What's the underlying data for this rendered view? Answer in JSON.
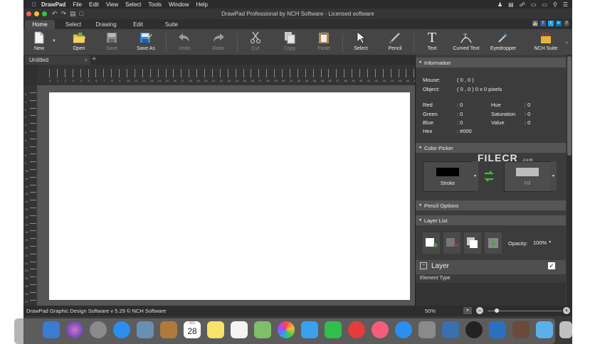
{
  "menubar": {
    "apple_icon": "apple-icon",
    "app_name": "DrawPad",
    "items": [
      "File",
      "Edit",
      "View",
      "Select",
      "Tools",
      "Window",
      "Help"
    ]
  },
  "window": {
    "title": "DrawPad Professional by NCH Software - Licensed software"
  },
  "ribbon": {
    "tabs": [
      "Home",
      "Select",
      "Drawing",
      "Edit",
      "Suite"
    ],
    "active_tab": "Home"
  },
  "toolbar": {
    "new": "New",
    "open": "Open",
    "save": "Save",
    "save_as": "Save As",
    "undo": "Undo",
    "redo": "Redo",
    "cut": "Cut",
    "copy": "Copy",
    "paste": "Paste",
    "select": "Select",
    "pencil": "Pencil",
    "text": "Text",
    "curved_text": "Curved Text",
    "eyedropper": "Eyedropper",
    "nch_suite": "NCH Suite"
  },
  "document": {
    "tab_label": "Untitled",
    "close_glyph": "×",
    "add_glyph": "+"
  },
  "ruler": {
    "h_labels": [
      "0",
      "1",
      "2",
      "3",
      "4",
      "5",
      "6",
      "7",
      "8",
      "9",
      "10",
      "11",
      "12",
      "13",
      "14",
      "15",
      "16",
      "17",
      "18",
      "19",
      "20",
      "21",
      "22",
      "23",
      "24",
      "25",
      "26",
      "27",
      "28",
      "29",
      "30",
      "31",
      "32",
      "33",
      "34",
      "35",
      "36",
      "37",
      "38",
      "39",
      "40",
      "41",
      "42",
      "43",
      "44",
      "45",
      "46",
      "47"
    ],
    "v_labels": [
      "0",
      "1",
      "2",
      "3",
      "4",
      "5",
      "6",
      "7",
      "8",
      "9",
      "10",
      "11",
      "12",
      "13",
      "14",
      "15",
      "16",
      "17",
      "18",
      "19",
      "20",
      "21",
      "22",
      "23",
      "24",
      "25",
      "26",
      "27"
    ]
  },
  "information": {
    "header": "Information",
    "mouse_label": "Mouse:",
    "mouse_value": "( 0 , 0 )",
    "object_label": "Object:",
    "object_value": "( 0 , 0 ) 0 x 0 pixels",
    "red_label": "Red",
    "red_value": ": 0",
    "green_label": "Green",
    "green_value": ": 0",
    "blue_label": "Blue",
    "blue_value": ": 0",
    "hex_label": "Hex",
    "hex_value": ": #000",
    "hue_label": "Hue",
    "hue_value": ": 0",
    "saturation_label": "Saturation",
    "saturation_value": ": 0",
    "value_label": "Value",
    "value_value": ": 0"
  },
  "color_picker": {
    "header": "Color Picker",
    "stroke_label": "Stroke",
    "fill_label": "Fill",
    "stroke_color": "#000000",
    "fill_color": "#bdbdbd"
  },
  "pencil_options": {
    "header": "Pencil Options"
  },
  "layer_list": {
    "header": "Layer List",
    "opacity_label": "Opacity:",
    "opacity_value": "100%",
    "layer_name": "Layer",
    "element_type_label": "Element Type"
  },
  "watermark": {
    "text": "FILECR",
    "sub": ".com"
  },
  "status": {
    "text": "DrawPad Graphic Design Software v 5.29 © NCH Software",
    "zoom": "50%"
  },
  "dock": {
    "calendar_month": "JUL",
    "calendar_day": "28"
  },
  "colors": {
    "close": "#ff5f57",
    "minimize": "#febc2e",
    "maximize": "#28c840",
    "panel_header": "#555555",
    "canvas": "#ffffff"
  }
}
